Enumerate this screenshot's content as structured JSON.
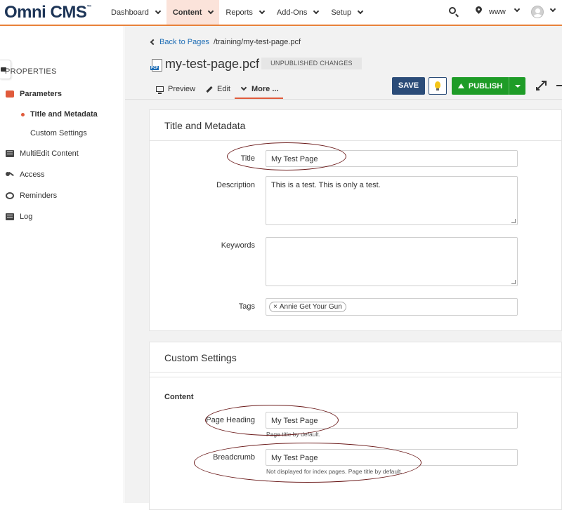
{
  "app": {
    "logo": "Omni CMS",
    "logo_tm": "™"
  },
  "nav": {
    "items": [
      {
        "label": "Dashboard",
        "active": false
      },
      {
        "label": "Content",
        "active": true
      },
      {
        "label": "Reports",
        "active": false
      },
      {
        "label": "Add-Ons",
        "active": false
      },
      {
        "label": "Setup",
        "active": false
      }
    ],
    "site_selector": "www"
  },
  "sidebar": {
    "section_title": "PROPERTIES",
    "items": [
      {
        "label": "Parameters",
        "icon": "briefcase-icon"
      },
      {
        "label": "MultiEdit Content",
        "icon": "list-icon"
      },
      {
        "label": "Access",
        "icon": "key-icon"
      },
      {
        "label": "Reminders",
        "icon": "alarm-icon"
      },
      {
        "label": "Log",
        "icon": "list-icon"
      }
    ],
    "subitems": [
      {
        "label": "Title and Metadata",
        "active": true
      },
      {
        "label": "Custom Settings",
        "active": false
      }
    ]
  },
  "page": {
    "back_label": "Back to Pages",
    "path": "/training/my-test-page.pcf",
    "file_badge": "PCF",
    "name": "my-test-page.pcf",
    "status_badge": "UNPUBLISHED CHANGES"
  },
  "tabs": {
    "preview": "Preview",
    "edit": "Edit",
    "more": "More ..."
  },
  "toolbar": {
    "save": "SAVE",
    "publish": "PUBLISH"
  },
  "title_metadata": {
    "heading": "Title and Metadata",
    "title_label": "Title",
    "title_value": "My Test Page",
    "description_label": "Description",
    "description_value": "This is a test. This is only a test.",
    "keywords_label": "Keywords",
    "keywords_value": "",
    "tags_label": "Tags",
    "tags": [
      "Annie Get Your Gun"
    ],
    "tag_remove": "×"
  },
  "custom_settings": {
    "heading": "Custom Settings",
    "group": "Content",
    "page_heading_label": "Page Heading",
    "page_heading_value": "My Test Page",
    "page_heading_help": "Page title by default.",
    "breadcrumb_label": "Breadcrumb",
    "breadcrumb_value": "My Test Page",
    "breadcrumb_help": "Not displayed for index pages. Page title by default."
  },
  "colors": {
    "accent": "#e05a3b",
    "save_button": "#2b4c78",
    "publish_button": "#1e9c27",
    "annotation": "#6b1a1a"
  }
}
